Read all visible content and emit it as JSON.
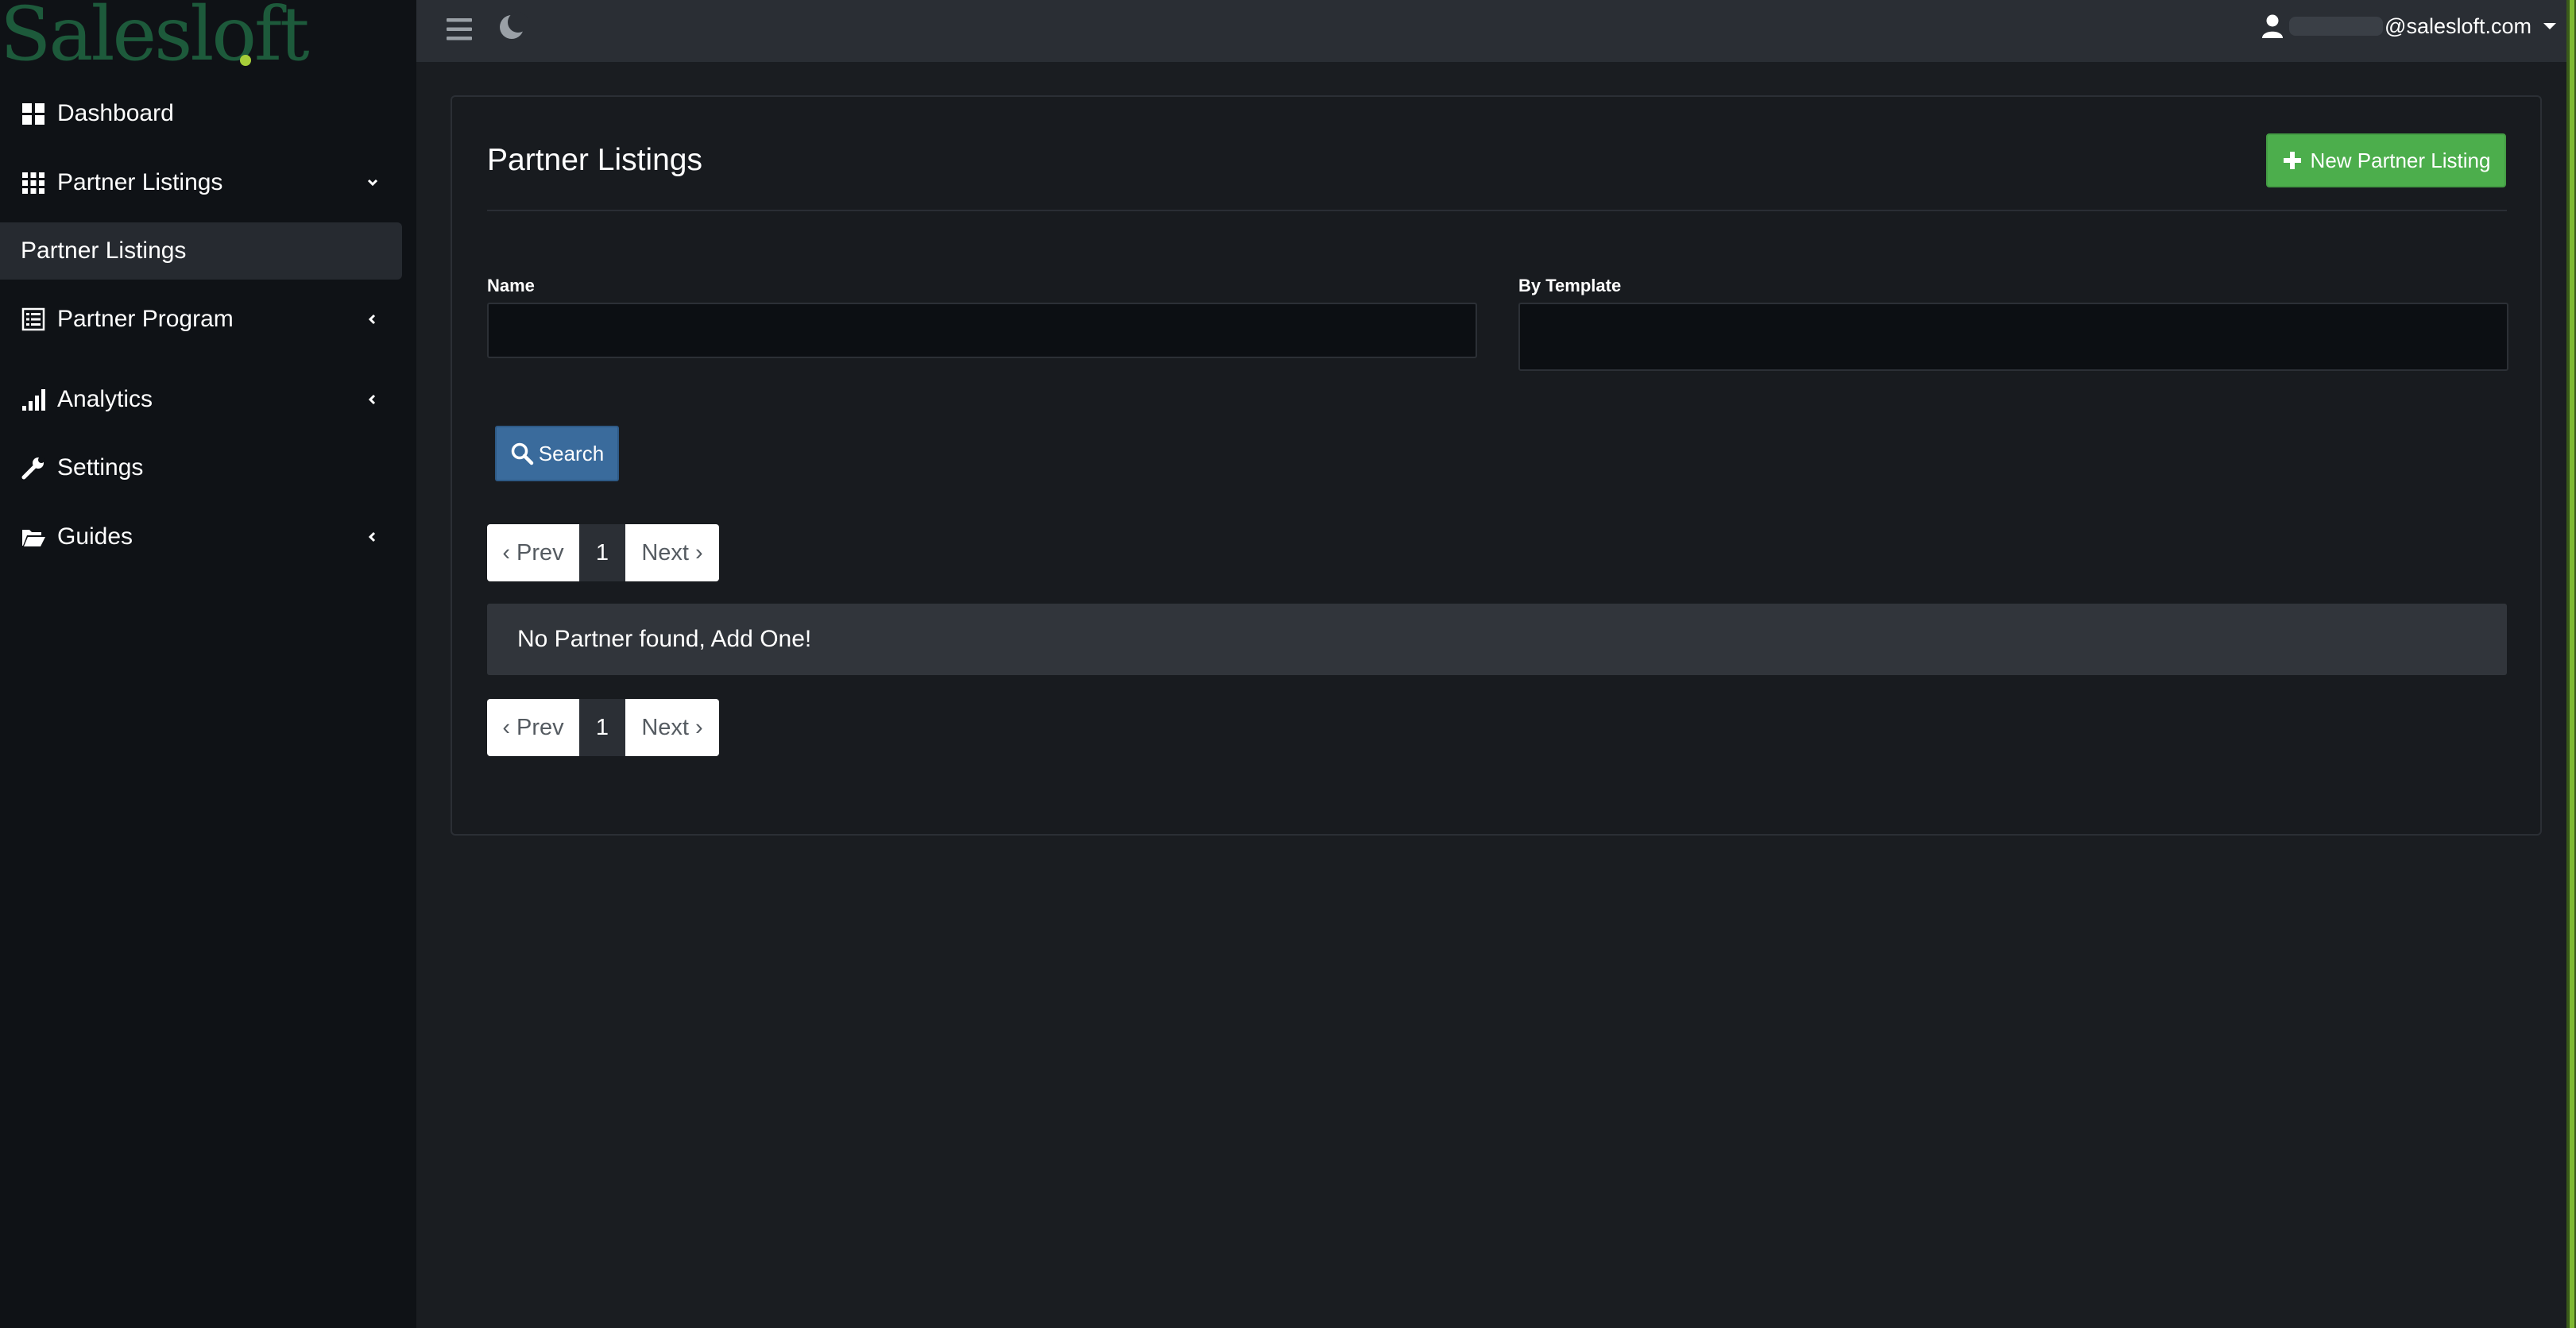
{
  "sidebar": {
    "logo": "Salesloft",
    "items": [
      {
        "label": "Dashboard",
        "icon": "dashboard-icon"
      },
      {
        "label": "Partner Listings",
        "icon": "grid-icon",
        "caret": "chevron-down-icon"
      },
      {
        "label": "Partner Listings",
        "sub": true
      },
      {
        "label": "Partner Program",
        "icon": "list-icon",
        "caret": "chevron-left-icon"
      },
      {
        "label": "Analytics",
        "icon": "signal-icon",
        "caret": "chevron-left-icon"
      },
      {
        "label": "Settings",
        "icon": "wrench-icon"
      },
      {
        "label": "Guides",
        "icon": "folder-open-icon",
        "caret": "chevron-left-icon"
      }
    ]
  },
  "topbar": {
    "user_email": "@salesloft.com"
  },
  "main": {
    "title": "Partner Listings",
    "new_button": "New Partner Listing",
    "fields": {
      "name_label": "Name",
      "name_value": "",
      "template_label": "By Template",
      "template_value": ""
    },
    "search_button": "Search",
    "pager": {
      "prev": "‹ Prev",
      "page": "1",
      "next": "Next ›"
    },
    "empty_message": "No Partner found, Add One!"
  },
  "colors": {
    "sidebar_bg": "#0f1216",
    "topbar_bg": "#2a2e34",
    "content_bg": "#1a1d21",
    "success": "#4cae4c",
    "primary": "#3a6b9c",
    "logo": "#1d5a3b",
    "logo_dot": "#a6ce39"
  }
}
